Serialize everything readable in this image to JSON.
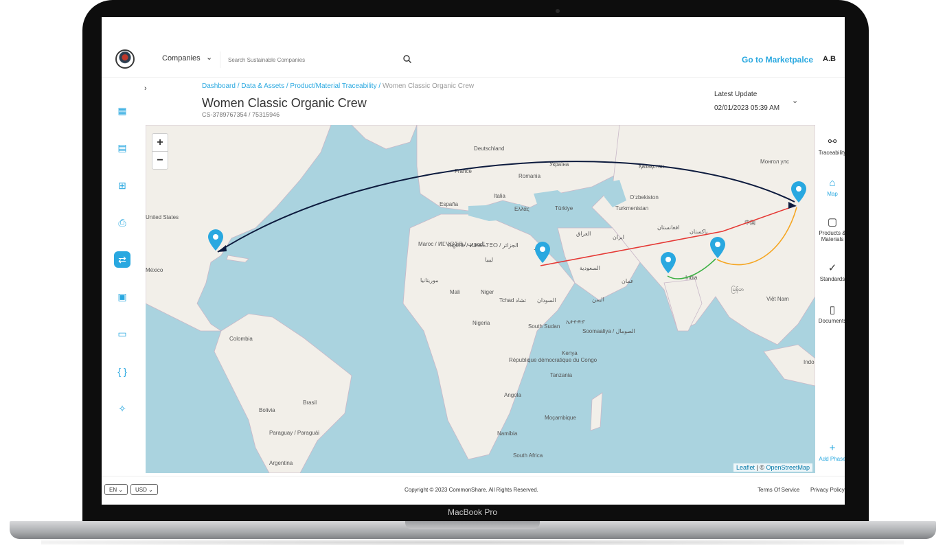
{
  "device": {
    "model": "MacBook Pro"
  },
  "header": {
    "companies_label": "Companies",
    "search_placeholder": "Search Sustainable Companies",
    "marketplace_link": "Go to Marketpalce",
    "user_initials": "A.B"
  },
  "breadcrumb": {
    "items": [
      "Dashboard",
      "Data & Assets",
      "Product/Material Traceability"
    ],
    "current": "Women Classic Organic Crew"
  },
  "page": {
    "title": "Women Classic Organic Crew",
    "subtitle": "CS-3789767354 / 75315946",
    "update_label": "Latest Update",
    "update_value": "02/01/2023 05:39 AM"
  },
  "left_nav": {
    "icons": [
      "dashboard-icon",
      "building-icon",
      "org-chart-icon",
      "document-search-icon",
      "traceability-arrows-icon",
      "newspaper-icon",
      "chat-icon",
      "code-braces-icon",
      "sparkle-icon"
    ],
    "active_index": 4
  },
  "map": {
    "zoom_in": "+",
    "zoom_out": "−",
    "attribution_leaflet": "Leaflet",
    "attribution_sep": " | © ",
    "attribution_osm": "OpenStreetMap",
    "labels": [
      "Deutschland",
      "France",
      "España",
      "Italia",
      "Україна",
      "Romania",
      "Ελλάς",
      "Türkiye",
      "Қазақстан",
      "Монгол улс",
      "Oʻzbekiston",
      "Turkmenistan",
      "افغانستان",
      "پاکستان",
      "ایران",
      "العراق",
      "مصر",
      "ليبيا",
      "السعودية",
      "عمان",
      "اليمن",
      "India",
      "中国",
      "မြန်မာ",
      "Việt Nam",
      "Indo",
      "United States",
      "México",
      "Colombia",
      "Brasil",
      "Bolivia",
      "Paraguay / Paraguái",
      "Argentina",
      "Maroc / ⵍⵎⵖⵔⵉⴱ / المغرب",
      "Algérie / ⵍⵣⵣⴰⵢⴻⵔ / الجزائر",
      "موريتانيا",
      "Mali",
      "Niger",
      "Tchad تشاد",
      "السودان",
      "Nigeria",
      "South Sudan",
      "ኢትዮጵያ",
      "Soomaaliya / الصومال",
      "Kenya",
      "République démocratique du Congo",
      "Tanzania",
      "Angola",
      "Namibia",
      "Moçambique",
      "South Africa"
    ]
  },
  "right_nav": {
    "items": [
      "Traceability",
      "Map",
      "Products & Materials",
      "Standards",
      "Documents"
    ],
    "active": "Map",
    "add_phase": "Add Phase"
  },
  "footer": {
    "language": "EN",
    "currency": "USD",
    "copyright": "Copyright © 2023 CommonShare. All Rights Reserved.",
    "terms": "Terms Of Service",
    "privacy": "Privacy Policy"
  },
  "colors": {
    "accent": "#29a8e0",
    "ocean": "#aad3df",
    "land": "#f2efe9",
    "route_red": "#e53935",
    "route_orange": "#f5a623",
    "route_green": "#3cb043",
    "route_navy": "#0d1b3e"
  }
}
